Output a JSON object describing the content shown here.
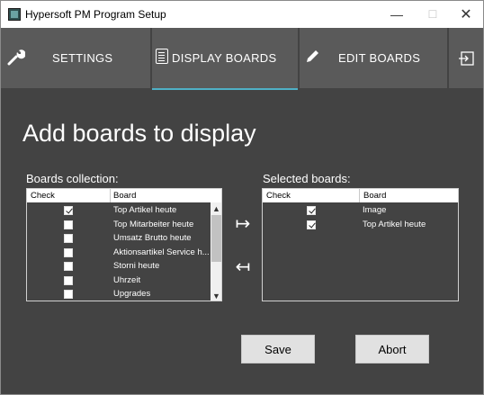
{
  "window": {
    "title": "Hypersoft PM Program Setup",
    "minimize_glyph": "—",
    "maximize_glyph": "☐",
    "close_glyph": "✕"
  },
  "tabs": [
    {
      "label": "SETTINGS",
      "icon": "wrench-icon",
      "active": false
    },
    {
      "label": "DISPLAY BOARDS",
      "icon": "document-list-icon",
      "active": true
    },
    {
      "label": "EDIT BOARDS",
      "icon": "pencil-icon",
      "active": false
    },
    {
      "label": "",
      "icon": "exit-icon",
      "active": false
    }
  ],
  "main": {
    "heading": "Add boards to display",
    "collection": {
      "label": "Boards collection:",
      "columns": [
        "Check",
        "Board"
      ],
      "rows": [
        {
          "checked": true,
          "board": "Top Artikel heute"
        },
        {
          "checked": false,
          "board": "Top Mitarbeiter heute"
        },
        {
          "checked": false,
          "board": "Umsatz Brutto heute"
        },
        {
          "checked": false,
          "board": "Aktionsartikel Service h..."
        },
        {
          "checked": false,
          "board": "Storni heute"
        },
        {
          "checked": false,
          "board": "Uhrzeit"
        },
        {
          "checked": false,
          "board": "Upgrades"
        }
      ]
    },
    "selected": {
      "label": "Selected boards:",
      "columns": [
        "Check",
        "Board"
      ],
      "rows": [
        {
          "checked": true,
          "board": "Image"
        },
        {
          "checked": true,
          "board": "Top Artikel heute"
        }
      ]
    },
    "move_right_glyph": "↦",
    "move_left_glyph": "↤",
    "save_label": "Save",
    "abort_label": "Abort"
  },
  "colors": {
    "background": "#434343",
    "tab_background": "#5a5a5a",
    "active_tab_underline": "#4fb0c6",
    "button_background": "#e1e1e1"
  }
}
